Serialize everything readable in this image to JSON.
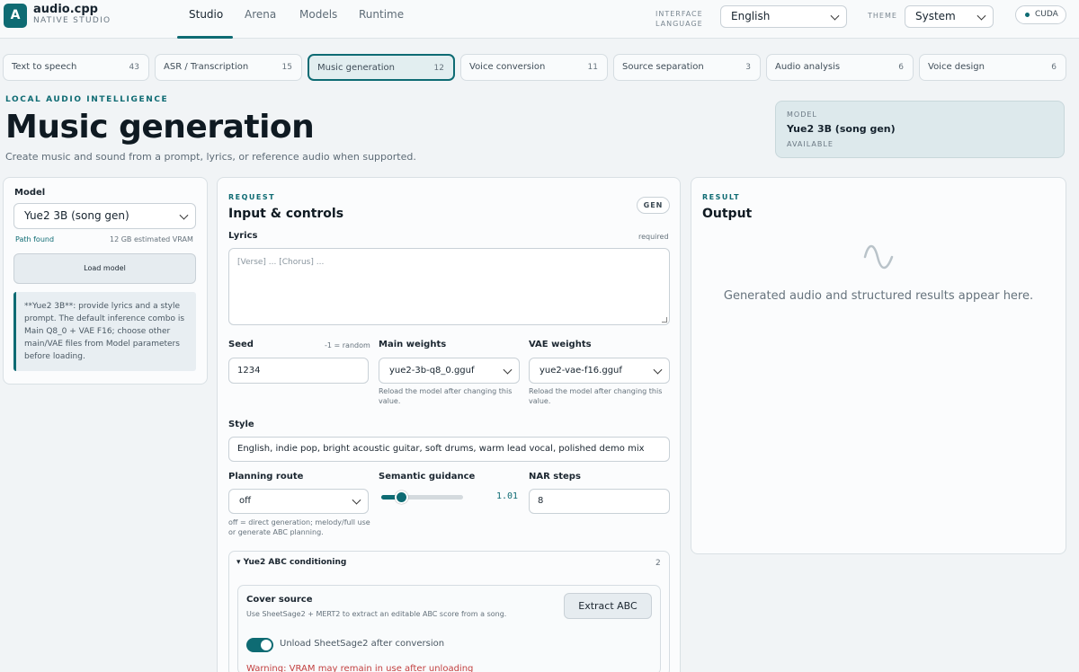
{
  "app": {
    "logo_letter": "A",
    "name": "audio.cpp",
    "subtitle": "NATIVE STUDIO"
  },
  "nav": [
    "Studio",
    "Arena",
    "Models",
    "Runtime"
  ],
  "header": {
    "interface_language_label": "INTERFACE LANGUAGE",
    "language_value": "English",
    "theme_label": "THEME",
    "theme_value": "System",
    "backend_badge": "CUDA"
  },
  "tabs": [
    {
      "label": "Text to speech",
      "count": "43"
    },
    {
      "label": "ASR / Transcription",
      "count": "15"
    },
    {
      "label": "Music generation",
      "count": "12"
    },
    {
      "label": "Voice conversion",
      "count": "11"
    },
    {
      "label": "Source separation",
      "count": "3"
    },
    {
      "label": "Audio analysis",
      "count": "6"
    },
    {
      "label": "Voice design",
      "count": "6"
    }
  ],
  "page": {
    "eyebrow": "LOCAL AUDIO INTELLIGENCE",
    "title": "Music generation",
    "description": "Create music and sound from a prompt, lyrics, or reference audio when supported."
  },
  "model_card": {
    "label": "MODEL",
    "name": "Yue2 3B (song gen)",
    "status": "AVAILABLE"
  },
  "model_panel": {
    "label": "Model",
    "selected": "Yue2 3B (song gen)",
    "path_status": "Path found",
    "vram": "12 GB estimated VRAM",
    "load_button": "Load model",
    "note": "**Yue2 3B**: provide lyrics and a style prompt. The default inference combo is Main Q8_0 + VAE F16; choose other main/VAE files from Model parameters before loading."
  },
  "request": {
    "eyebrow": "REQUEST",
    "title": "Input & controls",
    "badge": "GEN",
    "lyrics_label": "Lyrics",
    "lyrics_required": "required",
    "lyrics_placeholder": "[Verse] ... [Chorus] ...",
    "seed_label": "Seed",
    "seed_hint": "-1 = random",
    "seed_value": "1234",
    "main_weights_label": "Main weights",
    "main_weights_value": "yue2-3b-q8_0.gguf",
    "main_weights_hint": "Reload the model after changing this value.",
    "vae_weights_label": "VAE weights",
    "vae_weights_value": "yue2-vae-f16.gguf",
    "vae_weights_hint": "Reload the model after changing this value.",
    "style_label": "Style",
    "style_value": "English, indie pop, bright acoustic guitar, soft drums, warm lead vocal, polished demo mix",
    "planning_label": "Planning route",
    "planning_value": "off",
    "planning_hint": "off = direct generation; melody/full use or generate ABC planning.",
    "guidance_label": "Semantic guidance",
    "guidance_value": "1.01",
    "guidance_fraction": 0.24,
    "nar_label": "NAR steps",
    "nar_value": "8"
  },
  "abc": {
    "title": "Yue2 ABC conditioning",
    "count": "2",
    "cover_title": "Cover source",
    "cover_desc": "Use SheetSage2 + MERT2 to extract an editable ABC score from a song.",
    "extract_button": "Extract ABC",
    "toggle_label": "Unload SheetSage2 after conversion",
    "toggle_on": true,
    "warning": "Warning: VRAM may remain in use after unloading"
  },
  "result": {
    "eyebrow": "RESULT",
    "title": "Output",
    "icon": "waveform-icon",
    "empty_message": "Generated audio and structured results appear here."
  },
  "colors": {
    "accent": "#0e6b73",
    "background": "#f1f4f6",
    "warning": "#c24040"
  }
}
